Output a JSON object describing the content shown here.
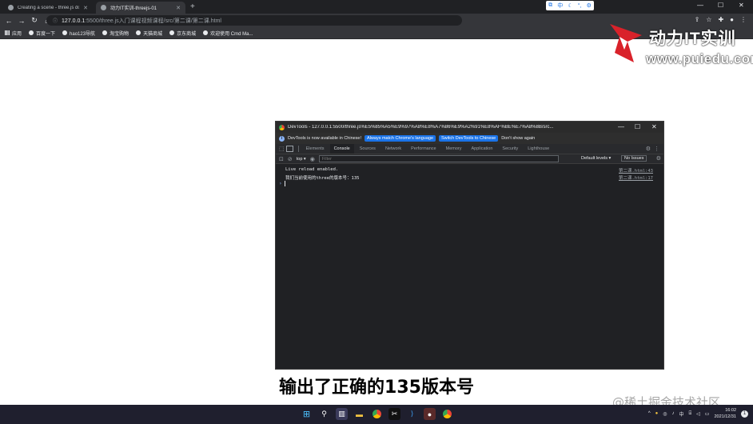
{
  "browser": {
    "tabs": [
      {
        "label": "Creating a scene - three.js do",
        "active": false
      },
      {
        "label": "动力IT实训-threejs-01",
        "active": true
      }
    ],
    "url": {
      "host": "127.0.0.1",
      "path": ":5500/three.js入门课程视频课程/src/第二课/第二课.html"
    },
    "bookmarks": [
      {
        "label": "应用",
        "icon": "apps-grid-icon"
      },
      {
        "label": "百度一下",
        "icon": "globe-icon"
      },
      {
        "label": "hao123导航",
        "icon": "globe-icon"
      },
      {
        "label": "淘宝购物",
        "icon": "globe-icon"
      },
      {
        "label": "天猫商城",
        "icon": "globe-icon"
      },
      {
        "label": "京东商城",
        "icon": "globe-icon"
      },
      {
        "label": "欢迎使用 Cmd Ma...",
        "icon": "globe-icon"
      }
    ],
    "ime": {
      "lang": "中"
    }
  },
  "watermark": {
    "brand": "动力IT实训",
    "domain": "www.puiedu.com",
    "juejin": "@稀土掘金技术社区"
  },
  "devtools": {
    "title": "DevTools - 127.0.0.1:5500/three.js%E5%85%A5%E9%97%A8%E8%A7%86%E9%A2%91%E8%AF%BE%E7%A8%8B/src...",
    "infobar": {
      "message": "DevTools is now available in Chinese!",
      "btn_match": "Always match Chrome's language",
      "btn_switch": "Switch DevTools to Chinese",
      "btn_dismiss": "Don't show again"
    },
    "tabs": [
      "Elements",
      "Console",
      "Sources",
      "Network",
      "Performance",
      "Memory",
      "Application",
      "Security",
      "Lighthouse"
    ],
    "active_tab": "Console",
    "toolbar": {
      "context": "top ▾",
      "filter_placeholder": "Filter",
      "levels": "Default levels ▾",
      "issues": "No Issues"
    },
    "console": [
      {
        "message": "Live reload enabled.",
        "source": "第二课.html:43"
      },
      {
        "message": "我们当前使用的three的版本号：135",
        "source": "第二课.html:17"
      }
    ]
  },
  "subtitle": "输出了正确的135版本号",
  "taskbar": {
    "time": "16:02",
    "date": "2021/12/31",
    "ime": "中"
  }
}
